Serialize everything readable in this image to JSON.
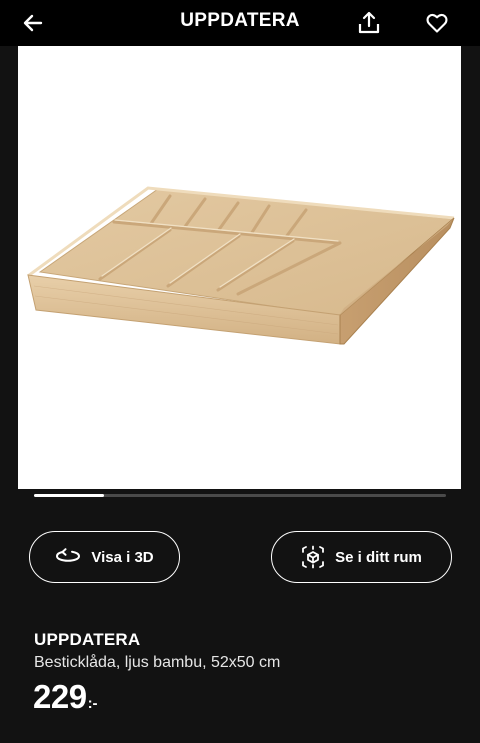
{
  "header": {
    "title": "UPPDATERA",
    "back_icon": "arrow-left-icon",
    "share_icon": "share-upload-icon",
    "favorite_icon": "heart-outline-icon"
  },
  "gallery": {
    "image_subject": "wooden cutlery tray",
    "current_slide_fraction": 0.17
  },
  "actions": {
    "view_3d_label": "Visa i 3D",
    "view_3d_icon": "rotate-3d-icon",
    "view_in_room_label": "Se i ditt rum",
    "view_in_room_icon": "ar-cube-icon"
  },
  "product": {
    "name": "UPPDATERA",
    "description": "Besticklåda, ljus bambu, 52x50 cm",
    "price": "229",
    "price_suffix": ":-"
  },
  "colors": {
    "background": "#121212",
    "topbar": "#000000",
    "text": "#ffffff",
    "wood_light": "#e0c39a",
    "wood_mid": "#d4b386",
    "wood_dark": "#c09a6b"
  }
}
